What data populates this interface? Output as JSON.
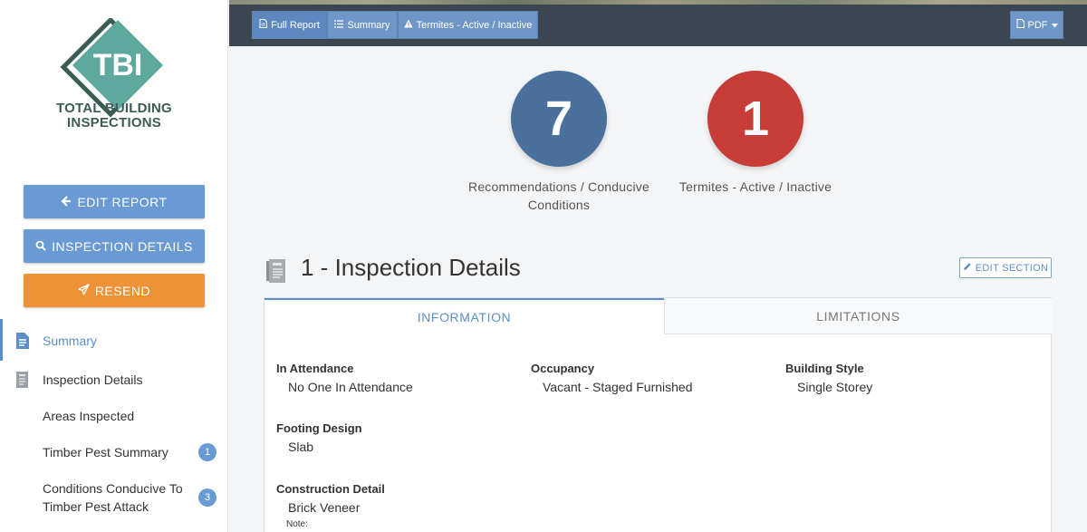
{
  "logo": {
    "abbrev": "TBI",
    "line1": "TOTAL BUILDING",
    "line2": "INSPECTIONS"
  },
  "sidebar": {
    "buttons": {
      "edit_report": "EDIT REPORT",
      "inspection_details": "INSPECTION DETAILS",
      "resend": "RESEND"
    },
    "nav": [
      {
        "label": "Summary",
        "active": true
      },
      {
        "label": "Inspection Details"
      },
      {
        "label": "Areas Inspected"
      },
      {
        "label": "Timber Pest Summary",
        "badge": "1"
      },
      {
        "label_line1": "Conditions Conducive To",
        "label_line2": "Timber Pest Attack",
        "badge": "3"
      }
    ]
  },
  "toolbar": {
    "full_report": "Full Report",
    "summary": "Summary",
    "termites": "Termites - Active / Inactive",
    "pdf": "PDF"
  },
  "stats": [
    {
      "value": "7",
      "caption_line1": "Recommendations / Conducive",
      "caption_line2": "Conditions",
      "color": "#4a719c"
    },
    {
      "value": "1",
      "caption_line1": "Termites - Active / Inactive",
      "caption_line2": "",
      "color": "#c73c37"
    }
  ],
  "section": {
    "title": "1 - Inspection Details",
    "edit_label": "EDIT SECTION",
    "tabs": [
      "INFORMATION",
      "LIMITATIONS"
    ],
    "active_tab": "INFORMATION",
    "fields": {
      "attendance": {
        "label": "In Attendance",
        "value": "No One In Attendance"
      },
      "occupancy": {
        "label": "Occupancy",
        "value": "Vacant - Staged Furnished"
      },
      "building_style": {
        "label": "Building Style",
        "value": "Single Storey"
      },
      "footing": {
        "label": "Footing Design",
        "value": "Slab"
      },
      "construction": {
        "label": "Construction Detail",
        "value": "Brick Veneer"
      }
    },
    "note_label": "Note:"
  },
  "colors": {
    "accent": "#5b8fc9",
    "button_blue": "#6a9ad4",
    "button_orange": "#ee9238",
    "topbar": "#3c4650",
    "stat_blue": "#4a719c",
    "stat_red": "#c73c37",
    "logo_teal": "#5fa89e"
  }
}
